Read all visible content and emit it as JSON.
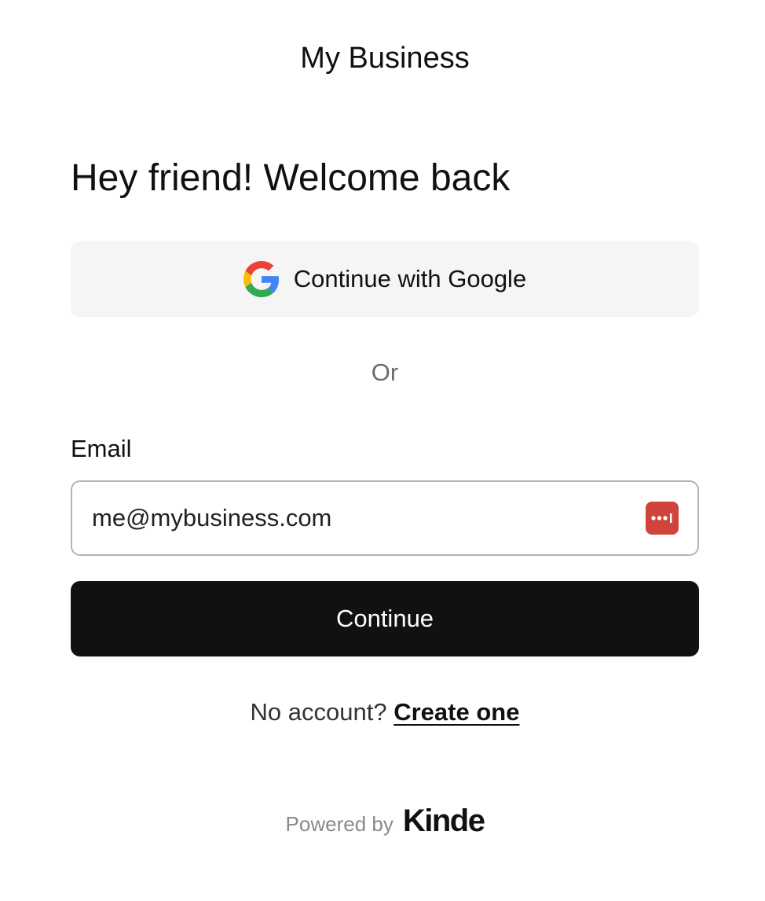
{
  "header": {
    "brand_title": "My Business"
  },
  "main": {
    "heading": "Hey friend! Welcome back",
    "google_button": {
      "label": "Continue with Google",
      "icon": "google-icon"
    },
    "divider_text": "Or",
    "email": {
      "label": "Email",
      "value": "me@mybusiness.com",
      "password_manager_icon": "password-manager-icon"
    },
    "continue_button": {
      "label": "Continue"
    },
    "signup": {
      "prompt": "No account?",
      "link_label": "Create one"
    }
  },
  "footer": {
    "powered_by": "Powered by",
    "logo_text": "Kinde"
  },
  "colors": {
    "primary_button": "#111111",
    "google_button_bg": "#f5f5f5",
    "password_manager_icon": "#d0453b",
    "muted_text": "#6b6b6b"
  }
}
